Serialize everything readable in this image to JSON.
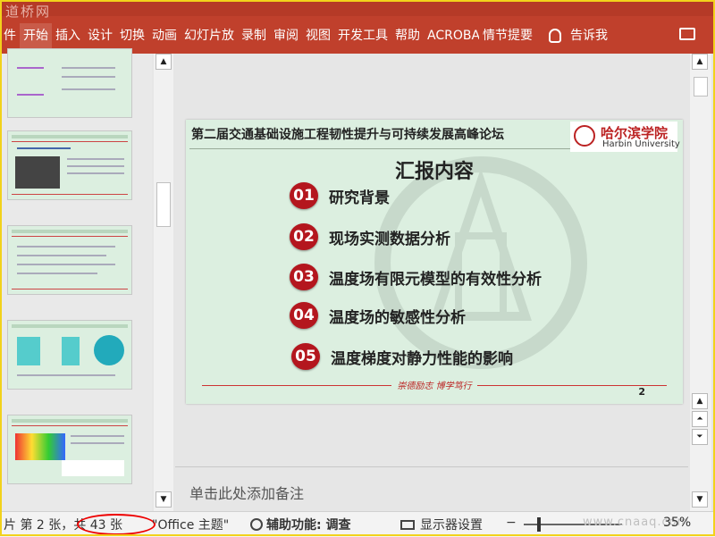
{
  "ribbon": {
    "brand": "道桥网",
    "tabs": [
      "件",
      "开始",
      "插入",
      "设计",
      "切换",
      "动画",
      "幻灯片放",
      "录制",
      "审阅",
      "视图",
      "开发工具",
      "帮助",
      "ACROBAT",
      "情节提要"
    ],
    "active_tab": "开始",
    "tell_me": "告诉我"
  },
  "slide": {
    "title": "第二届交通基础设施工程韧性提升与可持续发展高峰论坛",
    "logo_cn": "哈尔滨学院",
    "logo_en": "Harbin University",
    "heading": "汇报内容",
    "items": [
      {
        "num": "01",
        "label": "研究背景"
      },
      {
        "num": "02",
        "label": "现场实测数据分析"
      },
      {
        "num": "03",
        "label": "温度场有限元模型的有效性分析"
      },
      {
        "num": "04",
        "label": "温度场的敏感性分析"
      },
      {
        "num": "05",
        "label": "温度梯度对静力性能的影响"
      }
    ],
    "motto": "崇德励志 博学笃行",
    "page_number": "2"
  },
  "notes": {
    "placeholder": "单击此处添加备注"
  },
  "status": {
    "slide_info": "片 第 2 张，共 43 张",
    "theme": "\"Office 主题\"",
    "accessibility": "辅助功能: 调查",
    "display_settings": "显示器设置",
    "zoom_minus": "−",
    "zoom": "35%",
    "watermark": "www.cnaaq.com"
  },
  "colors": {
    "ribbon": "#c0402c",
    "accent_red": "#b4161e",
    "slide_bg": "#dcefe0"
  }
}
